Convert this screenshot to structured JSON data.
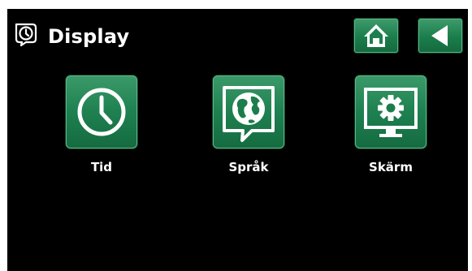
{
  "header": {
    "title": "Display",
    "title_icon": "display-settings-icon"
  },
  "nav": {
    "home_icon": "home-icon",
    "back_icon": "back-arrow-icon"
  },
  "tiles": [
    {
      "label": "Tid",
      "icon": "clock-icon"
    },
    {
      "label": "Språk",
      "icon": "globe-speech-icon"
    },
    {
      "label": "Skärm",
      "icon": "monitor-gear-icon"
    }
  ],
  "colors": {
    "background": "#000000",
    "button_green": "#1b7d4b",
    "button_green_light": "#3f9c6c",
    "text": "#ffffff"
  }
}
